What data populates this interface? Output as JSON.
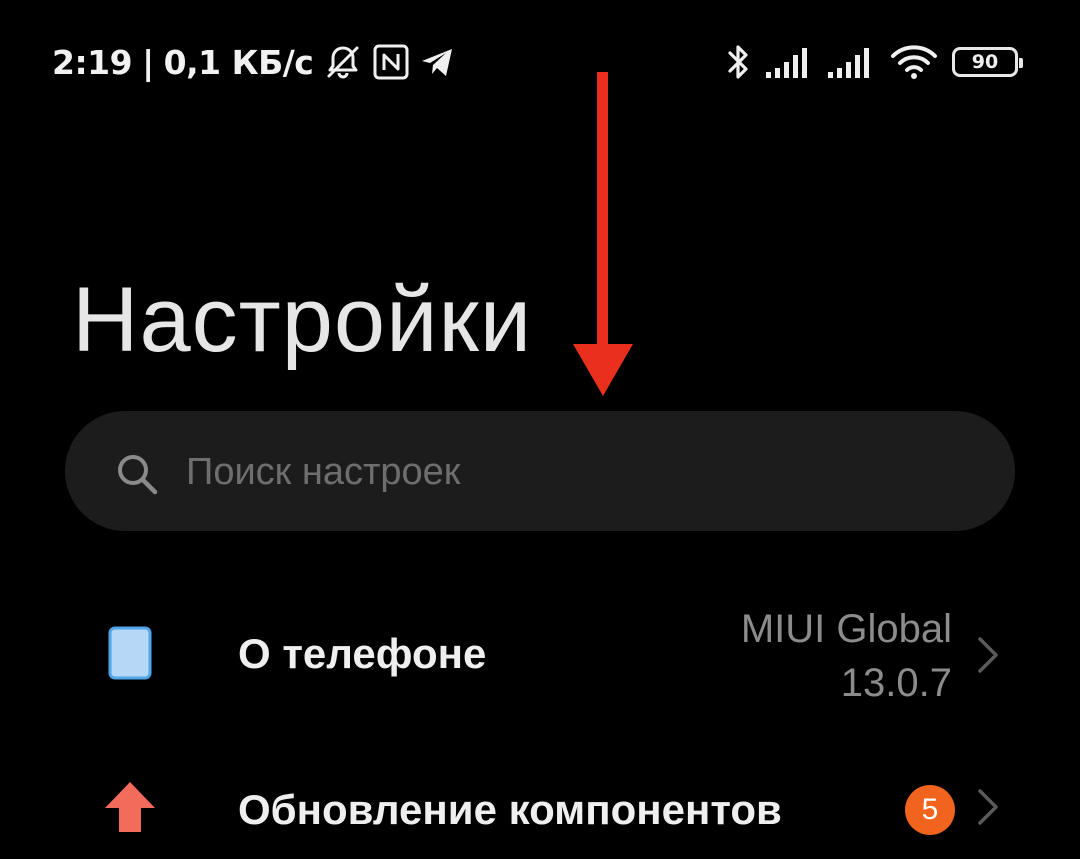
{
  "status_bar": {
    "time": "2:19",
    "separator": "|",
    "net_speed": "0,1 КБ/с",
    "icons_left": [
      "bell-off-icon",
      "nfc-icon",
      "telegram-icon"
    ],
    "icons_right": [
      "bluetooth-icon",
      "signal-icon",
      "signal-icon",
      "wifi-icon",
      "battery-icon"
    ],
    "battery_level": "90"
  },
  "annotation": {
    "arrow_color": "#e8301c"
  },
  "header": {
    "title": "Настройки"
  },
  "search": {
    "placeholder": "Поиск настроек"
  },
  "items": [
    {
      "label": "О телефоне",
      "icon": "phone-icon",
      "icon_color": "#8fc6f2",
      "value_line1": "MIUI Global",
      "value_line2": "13.0.7"
    },
    {
      "label": "Обновление компонентов",
      "icon": "update-arrow-icon",
      "icon_color": "#f26b5b",
      "badge": "5",
      "badge_color": "#f0641e"
    }
  ],
  "colors": {
    "background": "#000000",
    "search_bg": "#1c1c1c",
    "secondary_text": "#8c8c8c"
  }
}
